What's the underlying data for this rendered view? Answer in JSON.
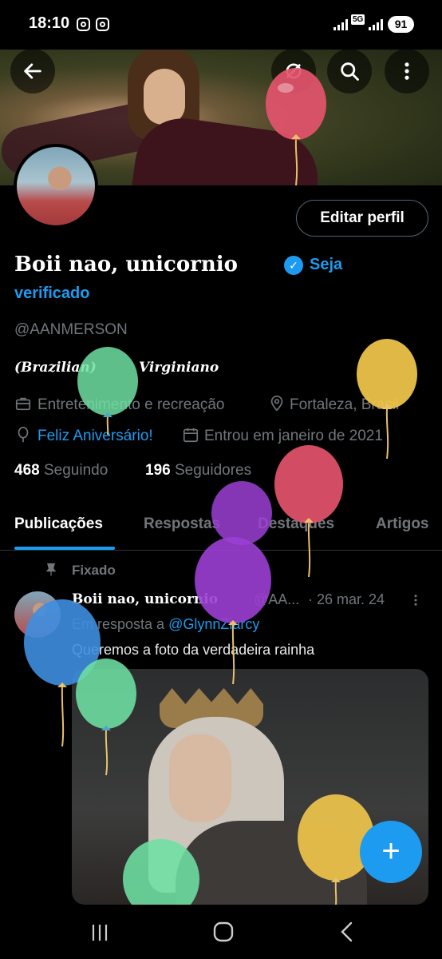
{
  "status_bar": {
    "time": "18:10",
    "network": "5G",
    "battery": "91"
  },
  "header": {
    "back_icon": "arrow-left-icon",
    "search_icon": "search-icon",
    "more_icon": "more-vertical-icon"
  },
  "profile": {
    "edit_label": "Editar perfil",
    "name": "Boii nao, unicornio",
    "verify_prefix": "Seja",
    "verify_suffix": "verificado",
    "handle": "@AANMERSON",
    "bio_left": "(Brazilian)",
    "bio_right": "Virginiano",
    "category": "Entretenimento e recreação",
    "location": "Fortaleza, Brasil",
    "birthday": "Feliz Aniversário!",
    "joined": "Entrou em janeiro de 2021",
    "following_count": "468",
    "following_label": "Seguindo",
    "followers_count": "196",
    "followers_label": "Seguidores"
  },
  "tabs": [
    {
      "label": "Publicações"
    },
    {
      "label": "Respostas"
    },
    {
      "label": "Destaques"
    },
    {
      "label": "Artigos"
    }
  ],
  "post": {
    "pinned_label": "Fixado",
    "author": "Boii nao, unicornio",
    "handle": "@AA...",
    "date": "· 26 mar. 24",
    "reply_prefix": "Em resposta a",
    "reply_handle": "@GlynnZiarcy",
    "text": "Queremos a foto da verdadeira rainha"
  },
  "fab": {
    "label": "+"
  },
  "colors": {
    "accent": "#1d9bf0",
    "background": "#000000",
    "secondary_text": "#71767b"
  }
}
